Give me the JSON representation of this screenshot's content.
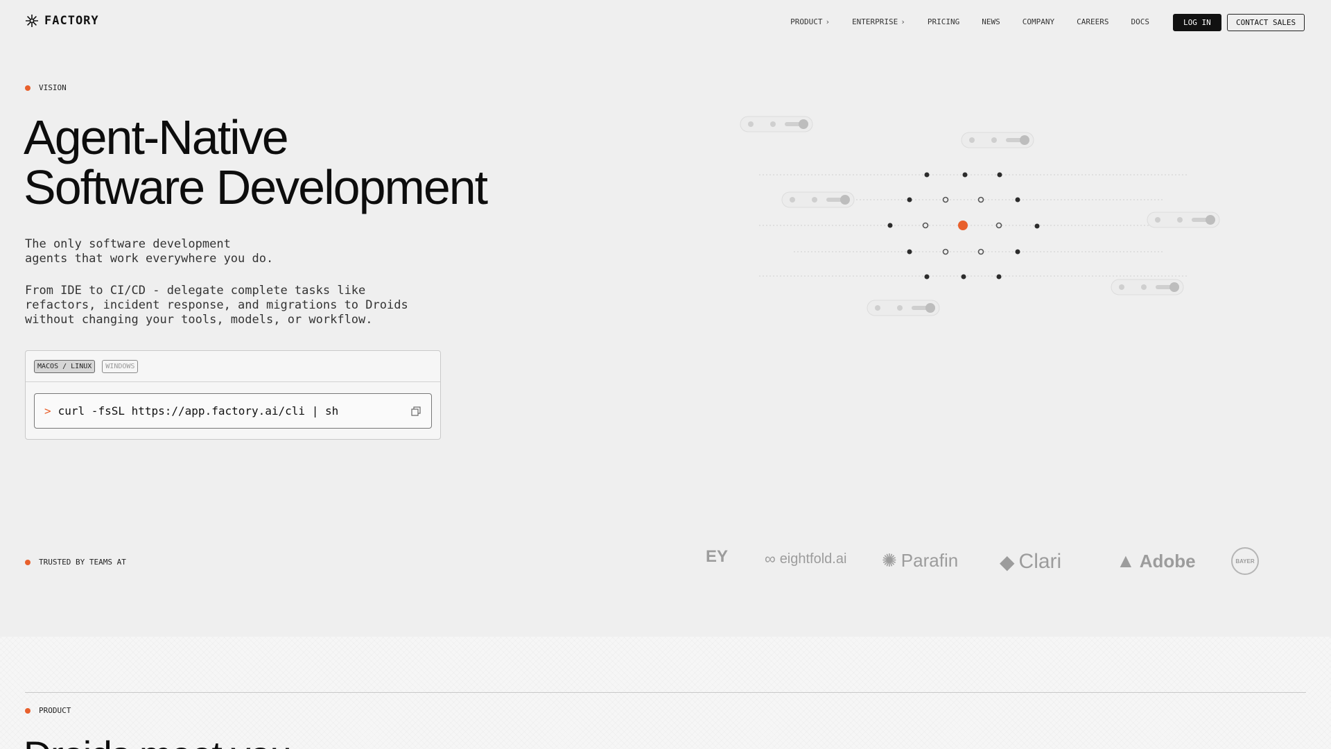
{
  "nav": {
    "brand": "FACTORY",
    "links": [
      {
        "label": "PRODUCT",
        "has_chevron": true
      },
      {
        "label": "ENTERPRISE",
        "has_chevron": true
      },
      {
        "label": "PRICING",
        "has_chevron": false
      },
      {
        "label": "NEWS",
        "has_chevron": false
      },
      {
        "label": "COMPANY",
        "has_chevron": false
      },
      {
        "label": "CAREERS",
        "has_chevron": false
      },
      {
        "label": "DOCS",
        "has_chevron": false
      }
    ],
    "login": "LOG IN",
    "contact": "CONTACT SALES"
  },
  "hero": {
    "section_label": "VISION",
    "title_line1": "Agent-Native",
    "title_line2": "Software Development",
    "desc1_line1": "The only software development",
    "desc1_line2": "agents that work everywhere you do.",
    "desc2_line1": "From IDE to CI/CD - delegate complete tasks like",
    "desc2_line2": "refactors, incident response, and migrations to Droids",
    "desc2_line3": "without changing your tools, models, or workflow."
  },
  "install": {
    "tabs": [
      {
        "label": "MACOS / LINUX",
        "active": true
      },
      {
        "label": "WINDOWS",
        "active": false
      }
    ],
    "prompt": ">",
    "command": "curl -fsSL https://app.factory.ai/cli | sh"
  },
  "trusted": {
    "label": "TRUSTED BY TEAMS AT",
    "logos": [
      "EY",
      "eightfold.ai",
      "Parafin",
      "Clari",
      "Adobe",
      "BAYER"
    ]
  },
  "product": {
    "section_label": "PRODUCT",
    "title": "Droids meet you"
  },
  "colors": {
    "accent": "#e8602c",
    "background": "#efefef",
    "text": "#111111"
  }
}
